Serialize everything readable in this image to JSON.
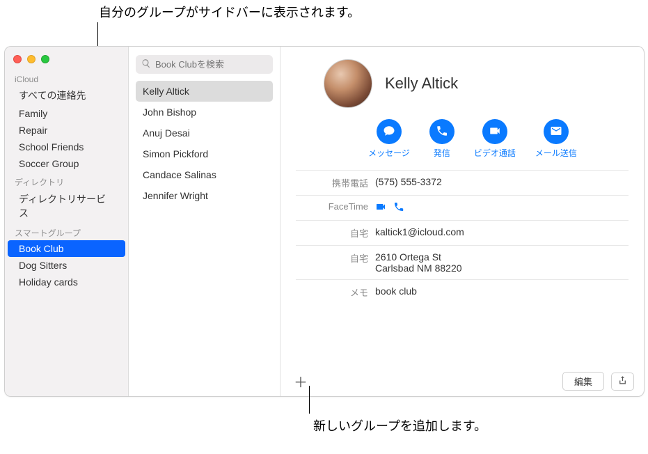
{
  "callouts": {
    "top": "自分のグループがサイドバーに表示されます。",
    "bottom": "新しいグループを追加します。"
  },
  "sidebar": {
    "sections": [
      {
        "header": "iCloud",
        "items": [
          {
            "label": "すべての連絡先",
            "selected": false
          },
          {
            "label": "Family",
            "selected": false
          },
          {
            "label": "Repair",
            "selected": false
          },
          {
            "label": "School Friends",
            "selected": false
          },
          {
            "label": "Soccer Group",
            "selected": false
          }
        ]
      },
      {
        "header": "ディレクトリ",
        "items": [
          {
            "label": "ディレクトリサービス",
            "selected": false
          }
        ]
      },
      {
        "header": "スマートグループ",
        "items": [
          {
            "label": "Book Club",
            "selected": true
          },
          {
            "label": "Dog Sitters",
            "selected": false
          },
          {
            "label": "Holiday cards",
            "selected": false
          }
        ]
      }
    ]
  },
  "search": {
    "placeholder": "Book Clubを検索"
  },
  "contacts": [
    {
      "name": "Kelly Altick",
      "selected": true
    },
    {
      "name": "John Bishop",
      "selected": false
    },
    {
      "name": "Anuj Desai",
      "selected": false
    },
    {
      "name": "Simon Pickford",
      "selected": false
    },
    {
      "name": "Candace Salinas",
      "selected": false
    },
    {
      "name": "Jennifer Wright",
      "selected": false
    }
  ],
  "detail": {
    "name": "Kelly Altick",
    "actions": {
      "message": "メッセージ",
      "call": "発信",
      "video": "ビデオ通話",
      "mail": "メール送信"
    },
    "fields": {
      "mobile_label": "携帯電話",
      "mobile_value": "(575) 555-3372",
      "facetime_label": "FaceTime",
      "home_email_label": "自宅",
      "home_email_value": "kaltick1@icloud.com",
      "home_addr_label": "自宅",
      "home_addr_line1": "2610 Ortega St",
      "home_addr_line2": "Carlsbad NM 88220",
      "memo_label": "メモ",
      "memo_value": "book club"
    },
    "buttons": {
      "edit": "編集"
    }
  }
}
